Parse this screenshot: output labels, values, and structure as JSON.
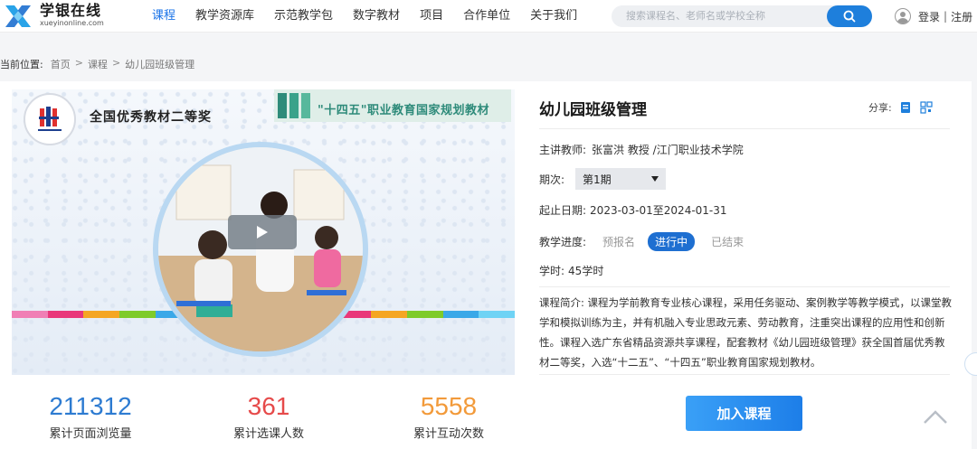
{
  "header": {
    "logo_cn": "学银在线",
    "logo_en": "xueyinonline.com",
    "nav": [
      "课程",
      "教学资源库",
      "示范教学包",
      "数字教材",
      "项目",
      "合作单位",
      "关于我们"
    ],
    "active_nav": 0,
    "search_placeholder": "搜索课程名、老师名或学校全称",
    "login": "登录",
    "register": "注册",
    "user_sep": "|"
  },
  "breadcrumb": {
    "label": "当前位置:",
    "items": [
      "首页",
      "课程",
      "幼儿园班级管理"
    ],
    "sep": ">"
  },
  "cover": {
    "award_text": "全国优秀教材二等奖",
    "banner_text": "\"十四五\"职业教育国家规划教材",
    "stripe_colors": [
      "#f07fb5",
      "#e9377a",
      "#f5a623",
      "#7ecb2a",
      "#3aa8e8",
      "#6fd3f5",
      "#b0a7e8",
      "#f2d43a",
      "#f58b7a",
      "#e9377a",
      "#f5a623",
      "#7ecb2a",
      "#3aa8e8",
      "#6fd3f5"
    ]
  },
  "stats": [
    {
      "value": "211312",
      "label": "累计页面浏览量",
      "color": "#2d7bd1"
    },
    {
      "value": "361",
      "label": "累计选课人数",
      "color": "#e64a4a"
    },
    {
      "value": "5558",
      "label": "累计互动次数",
      "color": "#f29a3a"
    }
  ],
  "course": {
    "title": "幼儿园班级管理",
    "share_label": "分享:",
    "teacher_label": "主讲教师:",
    "teacher_value": "张富洪 教授 /江门职业技术学院",
    "term_label": "期次:",
    "term_value": "第1期",
    "dates_label": "起止日期:",
    "dates_value": "2023-03-01至2024-01-31",
    "progress_label": "教学进度:",
    "progress_options": [
      "预报名",
      "进行中",
      "已结束"
    ],
    "progress_active": 1,
    "hours_label": "学时:",
    "hours_value": "45学时",
    "desc_label": "课程简介:",
    "desc_text": "课程为学前教育专业核心课程，采用任务驱动、案例教学等教学模式，以课堂教学和模拟训练为主，并有机融入专业思政元素、劳动教育，注重突出课程的应用性和创新性。课程入选广东省精品资源共享课程，配套教材《幼儿园班级管理》获全国首届优秀教材二等奖，入选“十二五”、“十四五”职业教育国家规划教材。",
    "join_label": "加入课程"
  }
}
